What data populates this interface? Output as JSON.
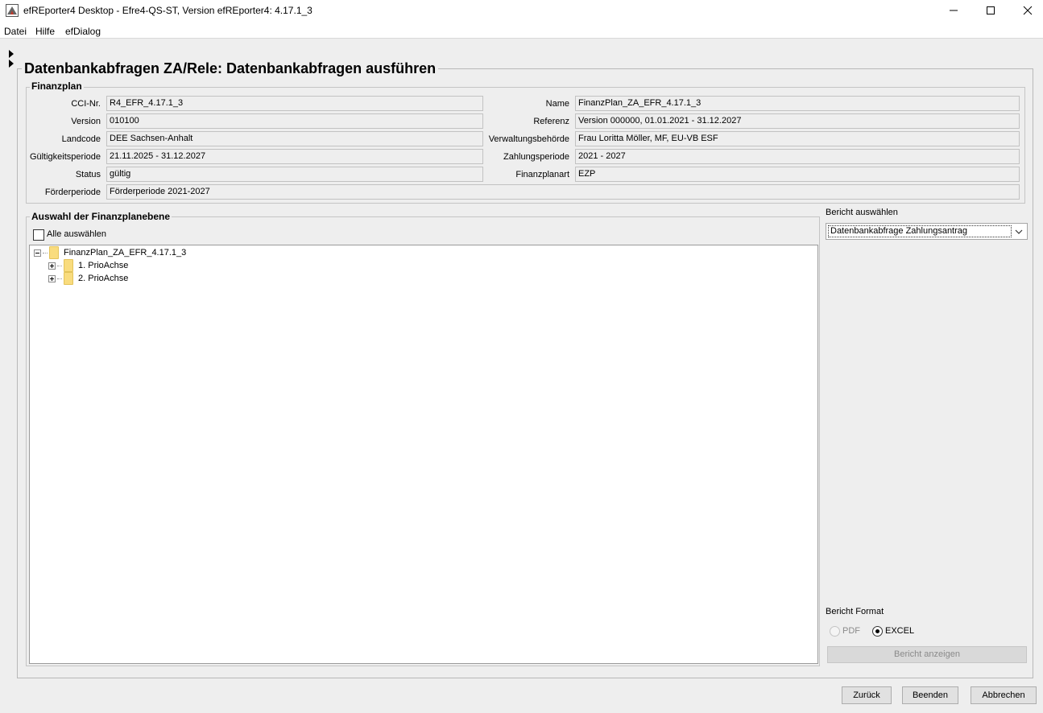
{
  "window": {
    "title": "efREporter4 Desktop - Efre4-QS-ST, Version efREporter4: 4.17.1_3",
    "minimize_icon": "minimize-icon",
    "maximize_icon": "maximize-icon",
    "close_icon": "close-icon"
  },
  "menu": {
    "items": [
      "Datei",
      "Hilfe",
      "efDialog"
    ]
  },
  "page": {
    "title": "Datenbankabfragen ZA/Rele: Datenbankabfragen ausführen"
  },
  "finanzplan": {
    "group_title": "Finanzplan",
    "fields": {
      "cci": {
        "label": "CCI-Nr.",
        "value": "R4_EFR_4.17.1_3"
      },
      "version": {
        "label": "Version",
        "value": "010100"
      },
      "landcode": {
        "label": "Landcode",
        "value": "DEE Sachsen-Anhalt"
      },
      "gueltigkeit": {
        "label": "Gültigkeitsperiode",
        "value": "21.11.2025 - 31.12.2027"
      },
      "status": {
        "label": "Status",
        "value": "gültig"
      },
      "foerder": {
        "label": "Förderperiode",
        "value": "Förderperiode 2021-2027"
      },
      "name": {
        "label": "Name",
        "value": "FinanzPlan_ZA_EFR_4.17.1_3"
      },
      "referenz": {
        "label": "Referenz",
        "value": "Version 000000,  01.01.2021 - 31.12.2027"
      },
      "verwaltung": {
        "label": "Verwaltungsbehörde",
        "value": "Frau Loritta Möller,  MF, EU-VB ESF"
      },
      "zahlung": {
        "label": "Zahlungsperiode",
        "value": "2021 - 2027"
      },
      "art": {
        "label": "Finanzplanart",
        "value": "EZP"
      }
    }
  },
  "selection": {
    "group_title": "Auswahl der Finanzplanebene",
    "select_all_label": "Alle auswählen",
    "select_all_checked": false,
    "tree": {
      "root": "FinanzPlan_ZA_EFR_4.17.1_3",
      "children": [
        "1. PrioAchse",
        "2. PrioAchse"
      ]
    }
  },
  "report": {
    "label": "Bericht auswählen",
    "selected": "Datenbankabfrage Zahlungsantrag",
    "format_label": "Bericht Format",
    "formats": [
      {
        "label": "PDF",
        "selected": false,
        "enabled": false
      },
      {
        "label": "EXCEL",
        "selected": true,
        "enabled": true
      }
    ],
    "show_button": "Bericht anzeigen"
  },
  "buttons": {
    "back": "Zurück",
    "finish": "Beenden",
    "cancel": "Abbrechen"
  },
  "colors": {
    "background": "#eeeeee",
    "folder": "#f9dc7e",
    "disabled_text": "#8a8a8a"
  }
}
